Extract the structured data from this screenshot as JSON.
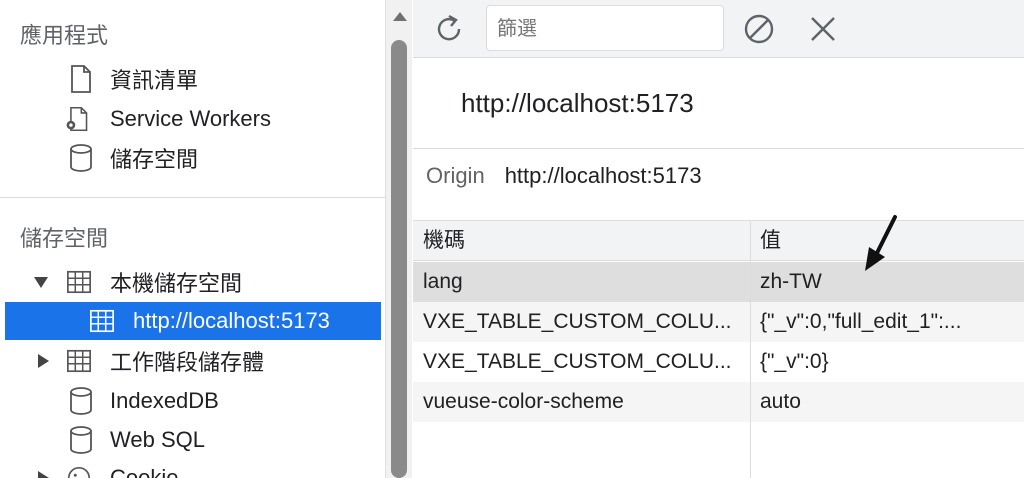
{
  "sidebar": {
    "app_section": "應用程式",
    "app_items": [
      {
        "label": "資訊清單",
        "icon": "document-icon"
      },
      {
        "label": "Service Workers",
        "icon": "gear-document-icon"
      },
      {
        "label": "儲存空間",
        "icon": "database-icon"
      }
    ],
    "storage_section": "儲存空間",
    "storage_items": [
      {
        "label": "本機儲存空間",
        "icon": "table-icon",
        "expanded": true
      },
      {
        "label": "http://localhost:5173",
        "icon": "table-icon",
        "selected": true
      },
      {
        "label": "工作階段儲存體",
        "icon": "table-icon",
        "expanded": false
      },
      {
        "label": "IndexedDB",
        "icon": "database-icon"
      },
      {
        "label": "Web SQL",
        "icon": "database-icon"
      },
      {
        "label": "Cookie",
        "icon": "cookie-icon",
        "expanded": false
      }
    ]
  },
  "toolbar": {
    "filter_placeholder": "篩選"
  },
  "main": {
    "origin_title": "http://localhost:5173",
    "origin_label": "Origin",
    "origin_value": "http://localhost:5173",
    "table": {
      "columns": [
        "機碼",
        "值"
      ],
      "rows": [
        {
          "key": "lang",
          "value": "zh-TW"
        },
        {
          "key": "VXE_TABLE_CUSTOM_COLU...",
          "value": "{\"_v\":0,\"full_edit_1\":..."
        },
        {
          "key": "VXE_TABLE_CUSTOM_COLU...",
          "value": "{\"_v\":0}"
        },
        {
          "key": "vueuse-color-scheme",
          "value": "auto"
        }
      ]
    }
  },
  "colors": {
    "selection": "#1a73e8",
    "toolbar_bg": "#f1f3f4",
    "row_highlight": "#dedede"
  }
}
